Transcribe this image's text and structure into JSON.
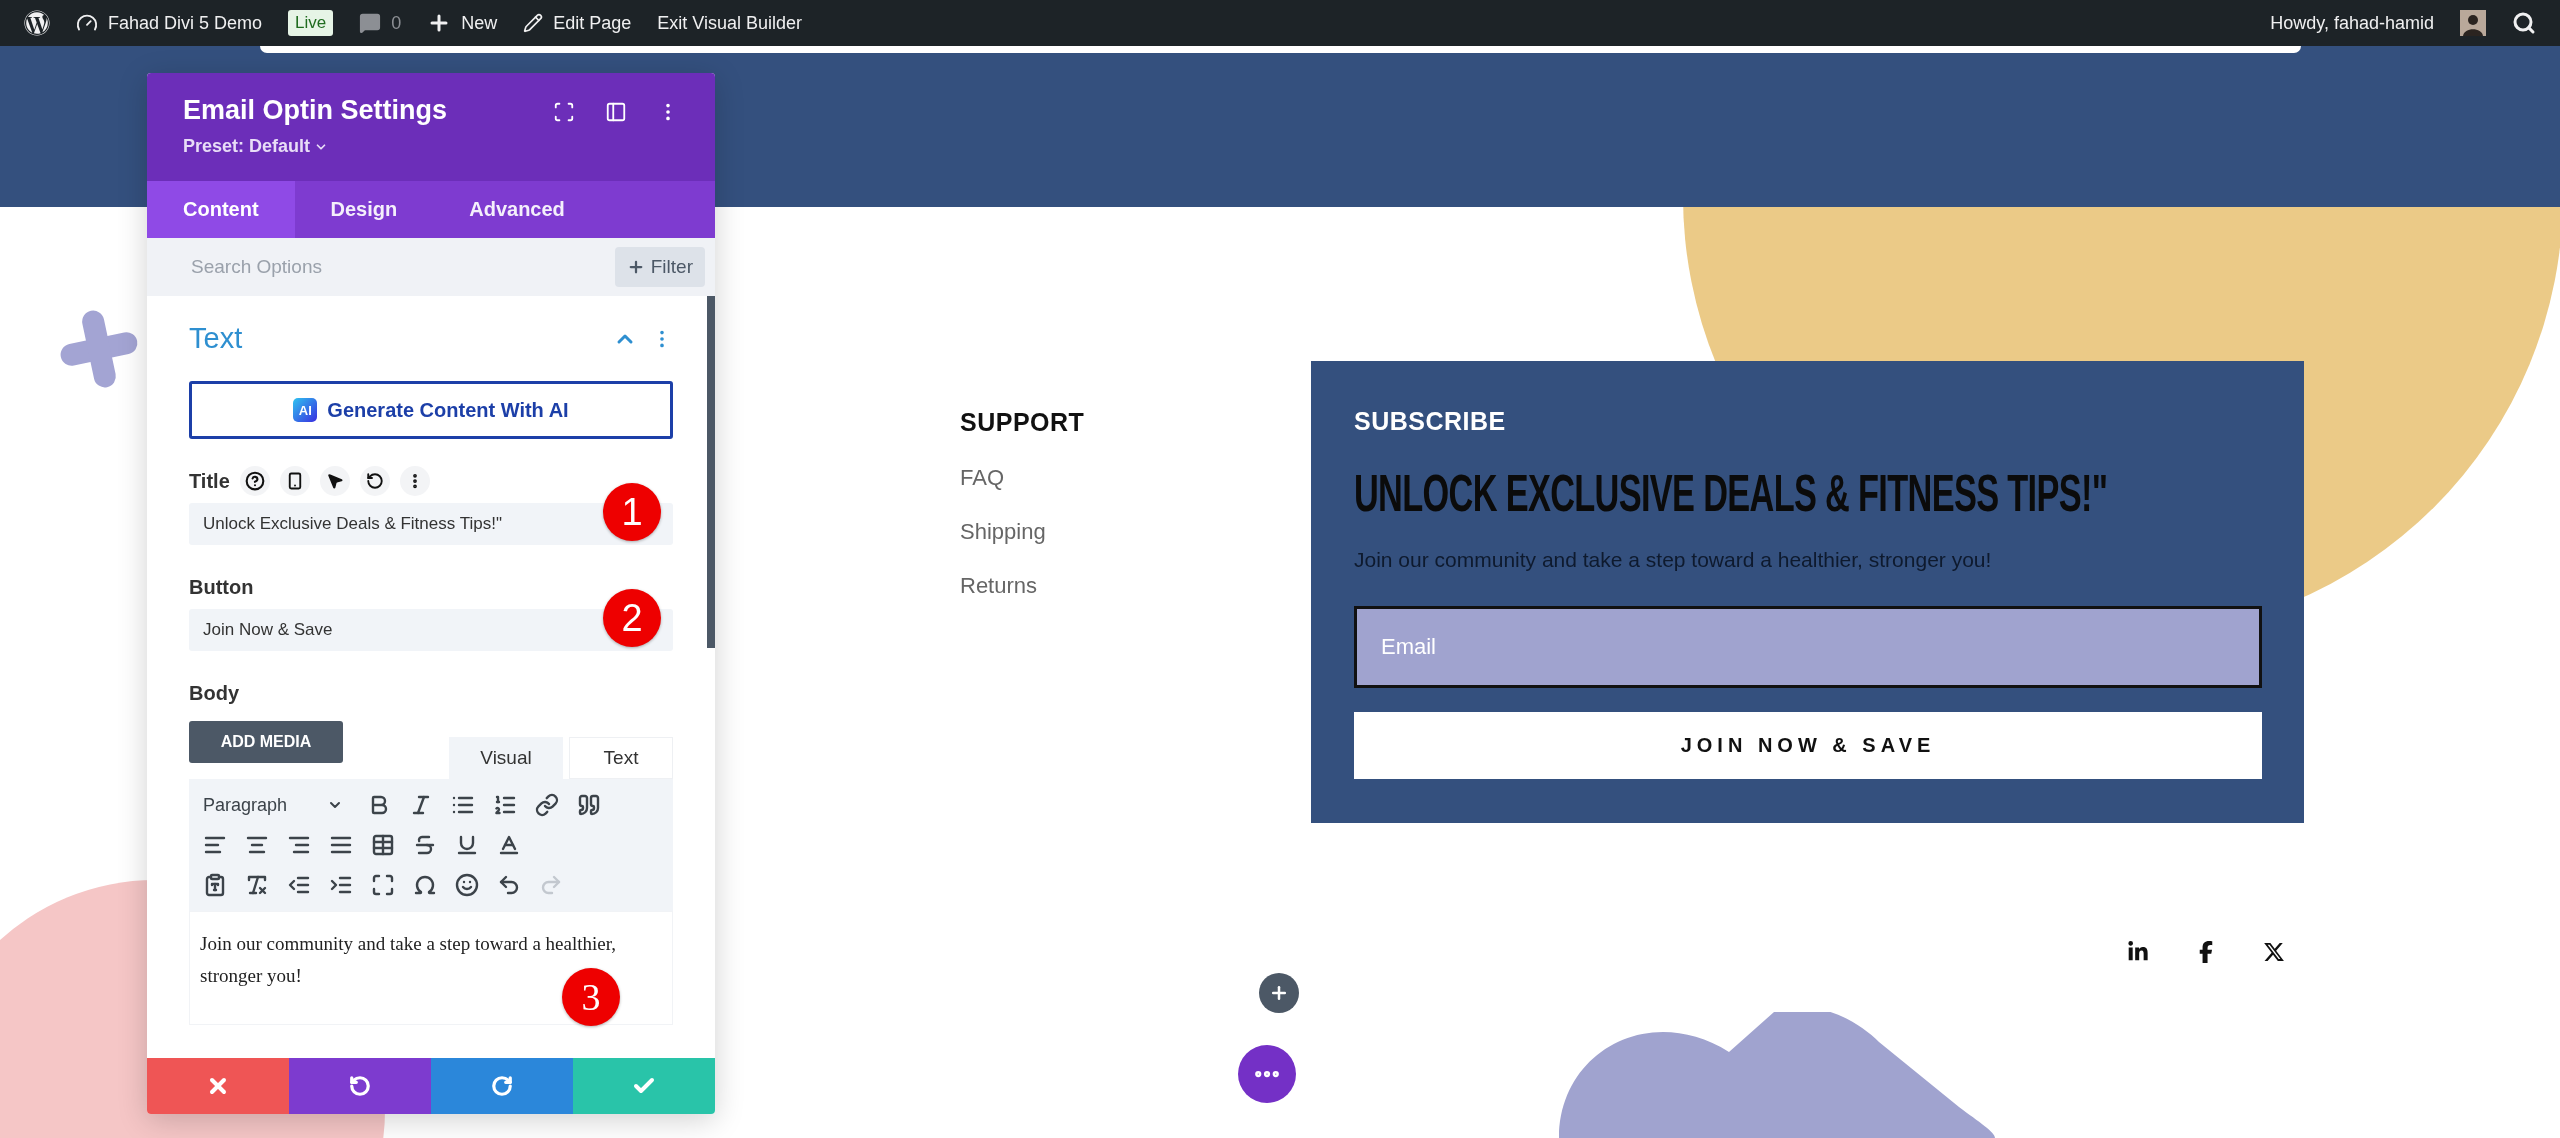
{
  "admin_bar": {
    "site": "Fahad Divi 5 Demo",
    "status": "Live",
    "comments": "0",
    "new": "New",
    "edit": "Edit Page",
    "exit": "Exit Visual Builder",
    "greeting": "Howdy, fahad-hamid"
  },
  "settings_panel": {
    "title": "Email Optin Settings",
    "preset": "Preset: Default",
    "tabs": [
      {
        "label": "Content",
        "selected": true
      },
      {
        "label": "Design",
        "selected": false
      },
      {
        "label": "Advanced",
        "selected": false
      }
    ],
    "search": {
      "placeholder": "Search Options"
    },
    "filter": "Filter",
    "section": {
      "title": "Text",
      "expanded": true
    },
    "ai_button": {
      "badge": "AI",
      "label": "Generate Content With AI"
    },
    "fields": [
      {
        "label": "Title",
        "value": "Unlock Exclusive Deals & Fitness Tips!\"",
        "marker": "1",
        "tools": true
      },
      {
        "label": "Button",
        "value": "Join Now & Save",
        "marker": "2",
        "tools": false
      }
    ],
    "body": {
      "label": "Body",
      "add_media": "ADD MEDIA",
      "editor_tabs": [
        {
          "label": "Visual",
          "selected": true
        },
        {
          "label": "Text",
          "selected": false
        }
      ],
      "format": "Paragraph",
      "redo_disabled": true,
      "content": "Join our community and take a step toward a healthier, stronger you!",
      "marker": "3"
    }
  },
  "support": {
    "heading": "SUPPORT",
    "links": [
      "FAQ",
      "Shipping",
      "Returns"
    ]
  },
  "subscribe": {
    "eyebrow": "SUBSCRIBE",
    "headline": "UNLOCK EXCLUSIVE DEALS & FITNESS TIPS!\"",
    "body": "Join our community and take a step toward a healthier, stronger you!",
    "email": {
      "placeholder": "Email"
    },
    "button": "JOIN NOW & SAVE"
  }
}
